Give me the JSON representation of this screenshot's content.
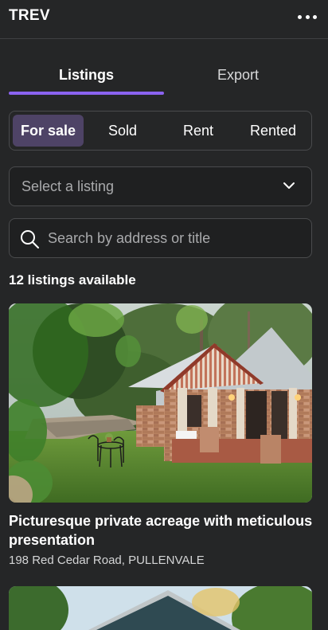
{
  "app": {
    "title": "TREV"
  },
  "tabs": [
    {
      "label": "Listings",
      "active": true
    },
    {
      "label": "Export",
      "active": false
    }
  ],
  "status_filter": {
    "options": [
      "For sale",
      "Sold",
      "Rent",
      "Rented"
    ],
    "selected": "For sale"
  },
  "listing_select": {
    "placeholder": "Select a listing"
  },
  "search": {
    "placeholder": "Search by address or title",
    "value": ""
  },
  "results": {
    "count_text": "12 listings available"
  },
  "listings": [
    {
      "title": "Picturesque private acreage with meticulous presentation",
      "address": "198 Red Cedar Road, PULLENVALE"
    }
  ],
  "colors": {
    "background": "#252627",
    "accent": "#8b63f0",
    "active_segment": "#4e4366",
    "border": "#4a4b4d"
  },
  "icons": [
    "more-horizontal-icon",
    "chevron-down-icon",
    "search-icon"
  ]
}
